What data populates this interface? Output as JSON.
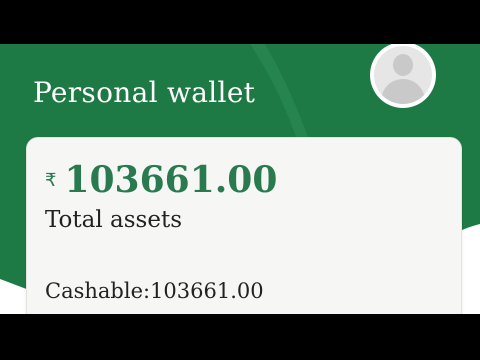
{
  "wallet": {
    "title": "Personal wallet"
  },
  "card": {
    "currency_symbol": "₹",
    "total_amount": "103661.00",
    "total_label": "Total assets",
    "cashable_text": "Cashable:103661.00"
  },
  "icons": {
    "avatar": "user-avatar-icon"
  },
  "colors": {
    "brand_green": "#1e7a45",
    "amount_green": "#2a7a4f",
    "card_bg": "#f6f7f5"
  }
}
